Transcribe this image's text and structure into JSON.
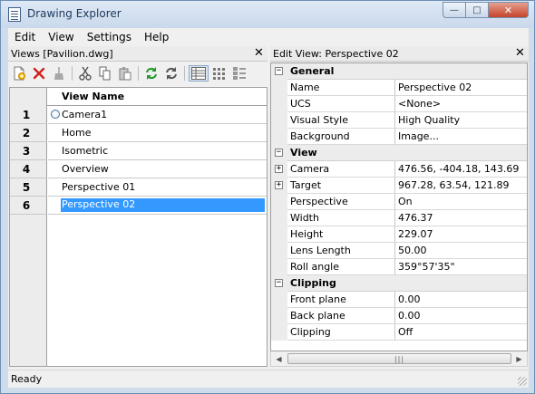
{
  "window": {
    "title": "Drawing Explorer",
    "min_label": "—",
    "max_label": "□",
    "close_label": "✕"
  },
  "menubar": [
    "Edit",
    "View",
    "Settings",
    "Help"
  ],
  "views_panel": {
    "title": "Views [Pavilion.dwg]",
    "close_label": "✕",
    "toolbar": [
      "new-view-icon",
      "delete-icon",
      "purge-icon",
      "cut-icon",
      "copy-icon",
      "paste-icon",
      "refresh-icon",
      "regenerate-icon",
      "table-view-icon",
      "thumbnail-view-icon",
      "tree-view-icon"
    ],
    "column_header": "View Name",
    "rows": [
      {
        "num": "1",
        "name": "Camera1",
        "current": true
      },
      {
        "num": "2",
        "name": "Home"
      },
      {
        "num": "3",
        "name": "Isometric"
      },
      {
        "num": "4",
        "name": "Overview"
      },
      {
        "num": "5",
        "name": "Perspective 01"
      },
      {
        "num": "6",
        "name": "Perspective 02",
        "selected": true
      }
    ]
  },
  "edit_panel": {
    "title": "Edit View: Perspective 02",
    "close_label": "✕",
    "groups": [
      {
        "name": "General",
        "collapse": "−",
        "props": [
          {
            "name": "Name",
            "value": "Perspective 02"
          },
          {
            "name": "UCS",
            "value": "<None>"
          },
          {
            "name": "Visual Style",
            "value": "High Quality"
          },
          {
            "name": "Background",
            "value": "Image..."
          }
        ]
      },
      {
        "name": "View",
        "collapse": "−",
        "props": [
          {
            "name": "Camera",
            "value": "476.56, -404.18, 143.69",
            "expand": "+"
          },
          {
            "name": "Target",
            "value": "967.28, 63.54, 121.89",
            "expand": "+"
          },
          {
            "name": "Perspective",
            "value": "On"
          },
          {
            "name": "Width",
            "value": "476.37"
          },
          {
            "name": "Height",
            "value": "229.07"
          },
          {
            "name": "Lens Length",
            "value": "50.00"
          },
          {
            "name": "Roll angle",
            "value": "359°57'35\""
          }
        ]
      },
      {
        "name": "Clipping",
        "collapse": "−",
        "props": [
          {
            "name": "Front plane",
            "value": "0.00"
          },
          {
            "name": "Back plane",
            "value": "0.00"
          },
          {
            "name": "Clipping",
            "value": "Off"
          }
        ]
      }
    ],
    "scroll": {
      "left": "◀",
      "right": "▶",
      "thumb": "|||"
    }
  },
  "status": "Ready",
  "colors": {
    "selection": "#3399ff",
    "title_text": "#1e395b",
    "close_button": "#c4432a"
  }
}
